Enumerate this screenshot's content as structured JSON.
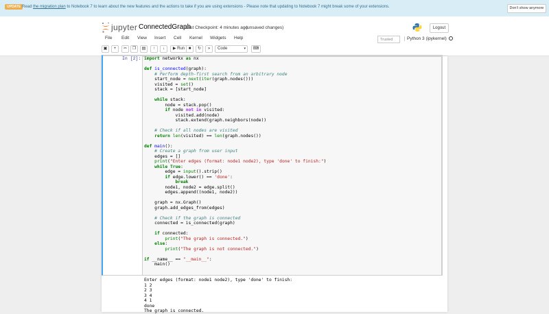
{
  "banner": {
    "badge": "UPDATE",
    "text_before": "Read ",
    "link": "the migration plan",
    "text_after": " to Notebook 7 to learn about the new features and the actions to take if you are using extensions - Please note that updating to Notebook 7 might break some of your extensions.",
    "dismiss_label": "Don't show anymore"
  },
  "header": {
    "logo_text": "jupyter",
    "notebook_name": "ConnectedGraph",
    "checkpoint": "Last Checkpoint: 4 minutes ago",
    "save_status": "(unsaved changes)",
    "logout_label": "Logout"
  },
  "menu": [
    "File",
    "Edit",
    "View",
    "Insert",
    "Cell",
    "Kernel",
    "Widgets",
    "Help"
  ],
  "trusted_label": "Trusted",
  "kernel_label": "Python 3 (ipykernel)",
  "toolbar": {
    "run_label": "Run",
    "cell_type": "Code",
    "icons": [
      "save-icon",
      "add-cell-icon",
      "cut-icon",
      "copy-icon",
      "paste-icon",
      "move-up-icon",
      "move-down-icon",
      "run-icon",
      "interrupt-icon",
      "restart-icon",
      "restart-run-all-icon",
      "command-palette-icon"
    ]
  },
  "cell": {
    "prompt": "In [2]:",
    "code_lines": [
      [
        {
          "t": "import",
          "c": "kw"
        },
        {
          "t": " networkx "
        },
        {
          "t": "as",
          "c": "kw"
        },
        {
          "t": " nx"
        }
      ],
      [],
      [
        {
          "t": "def",
          "c": "kw"
        },
        {
          "t": " "
        },
        {
          "t": "is_connected",
          "c": "fn"
        },
        {
          "t": "(graph):"
        }
      ],
      [
        {
          "t": "    "
        },
        {
          "t": "# Perform depth-first search from an arbitrary node",
          "c": "cm"
        }
      ],
      [
        {
          "t": "    start_node = "
        },
        {
          "t": "next",
          "c": "bi"
        },
        {
          "t": "("
        },
        {
          "t": "iter",
          "c": "bi"
        },
        {
          "t": "(graph.nodes()))"
        }
      ],
      [
        {
          "t": "    visited = "
        },
        {
          "t": "set",
          "c": "bi"
        },
        {
          "t": "()"
        }
      ],
      [
        {
          "t": "    stack = [start_node]"
        }
      ],
      [],
      [
        {
          "t": "    "
        },
        {
          "t": "while",
          "c": "kw"
        },
        {
          "t": " stack:"
        }
      ],
      [
        {
          "t": "        node = stack.pop()"
        }
      ],
      [
        {
          "t": "        "
        },
        {
          "t": "if",
          "c": "kw"
        },
        {
          "t": " node "
        },
        {
          "t": "not in",
          "c": "op"
        },
        {
          "t": " visited:"
        }
      ],
      [
        {
          "t": "            visited.add(node)"
        }
      ],
      [
        {
          "t": "            stack.extend(graph.neighbors(node))"
        }
      ],
      [],
      [
        {
          "t": "    "
        },
        {
          "t": "# Check if all nodes are visited",
          "c": "cm"
        }
      ],
      [
        {
          "t": "    "
        },
        {
          "t": "return",
          "c": "kw"
        },
        {
          "t": " "
        },
        {
          "t": "len",
          "c": "bi"
        },
        {
          "t": "(visited) == "
        },
        {
          "t": "len",
          "c": "bi"
        },
        {
          "t": "(graph.nodes())"
        }
      ],
      [],
      [
        {
          "t": "def",
          "c": "kw"
        },
        {
          "t": " "
        },
        {
          "t": "main",
          "c": "fn"
        },
        {
          "t": "():"
        }
      ],
      [
        {
          "t": "    "
        },
        {
          "t": "# Create a graph from user input",
          "c": "cm"
        }
      ],
      [
        {
          "t": "    edges = []"
        }
      ],
      [
        {
          "t": "    "
        },
        {
          "t": "print",
          "c": "bi"
        },
        {
          "t": "("
        },
        {
          "t": "\"Enter edges (format: node1 node2), type 'done' to finish:\"",
          "c": "st"
        },
        {
          "t": ")"
        }
      ],
      [
        {
          "t": "    "
        },
        {
          "t": "while",
          "c": "kw"
        },
        {
          "t": " "
        },
        {
          "t": "True",
          "c": "kw"
        },
        {
          "t": ":"
        }
      ],
      [
        {
          "t": "        edge = "
        },
        {
          "t": "input",
          "c": "bi"
        },
        {
          "t": "().strip()"
        }
      ],
      [
        {
          "t": "        "
        },
        {
          "t": "if",
          "c": "kw"
        },
        {
          "t": " edge.lower() == "
        },
        {
          "t": "'done'",
          "c": "st"
        },
        {
          "t": ":"
        }
      ],
      [
        {
          "t": "            "
        },
        {
          "t": "break",
          "c": "kw"
        }
      ],
      [
        {
          "t": "        node1, node2 = edge.split()"
        }
      ],
      [
        {
          "t": "        edges.append((node1, node2))"
        }
      ],
      [],
      [
        {
          "t": "    graph = nx.Graph()"
        }
      ],
      [
        {
          "t": "    graph.add_edges_from(edges)"
        }
      ],
      [],
      [
        {
          "t": "    "
        },
        {
          "t": "# Check if the graph is connected",
          "c": "cm"
        }
      ],
      [
        {
          "t": "    connected = is_connected(graph)"
        }
      ],
      [],
      [
        {
          "t": "    "
        },
        {
          "t": "if",
          "c": "kw"
        },
        {
          "t": " connected:"
        }
      ],
      [
        {
          "t": "        "
        },
        {
          "t": "print",
          "c": "bi"
        },
        {
          "t": "("
        },
        {
          "t": "\"The graph is connected.\"",
          "c": "st"
        },
        {
          "t": ")"
        }
      ],
      [
        {
          "t": "    "
        },
        {
          "t": "else",
          "c": "kw"
        },
        {
          "t": ":"
        }
      ],
      [
        {
          "t": "        "
        },
        {
          "t": "print",
          "c": "bi"
        },
        {
          "t": "("
        },
        {
          "t": "\"The graph is not connected.\"",
          "c": "st"
        },
        {
          "t": ")"
        }
      ],
      [],
      [
        {
          "t": "if",
          "c": "kw"
        },
        {
          "t": " __name__ == "
        },
        {
          "t": "\"__main__\"",
          "c": "st"
        },
        {
          "t": ":"
        }
      ],
      [
        {
          "t": "    main()"
        }
      ]
    ],
    "output_lines": [
      "Enter edges (format: node1 node2), type 'done' to finish:",
      "1 2",
      "2 3",
      "3 4",
      "4 1",
      "done",
      "The graph is connected."
    ]
  }
}
